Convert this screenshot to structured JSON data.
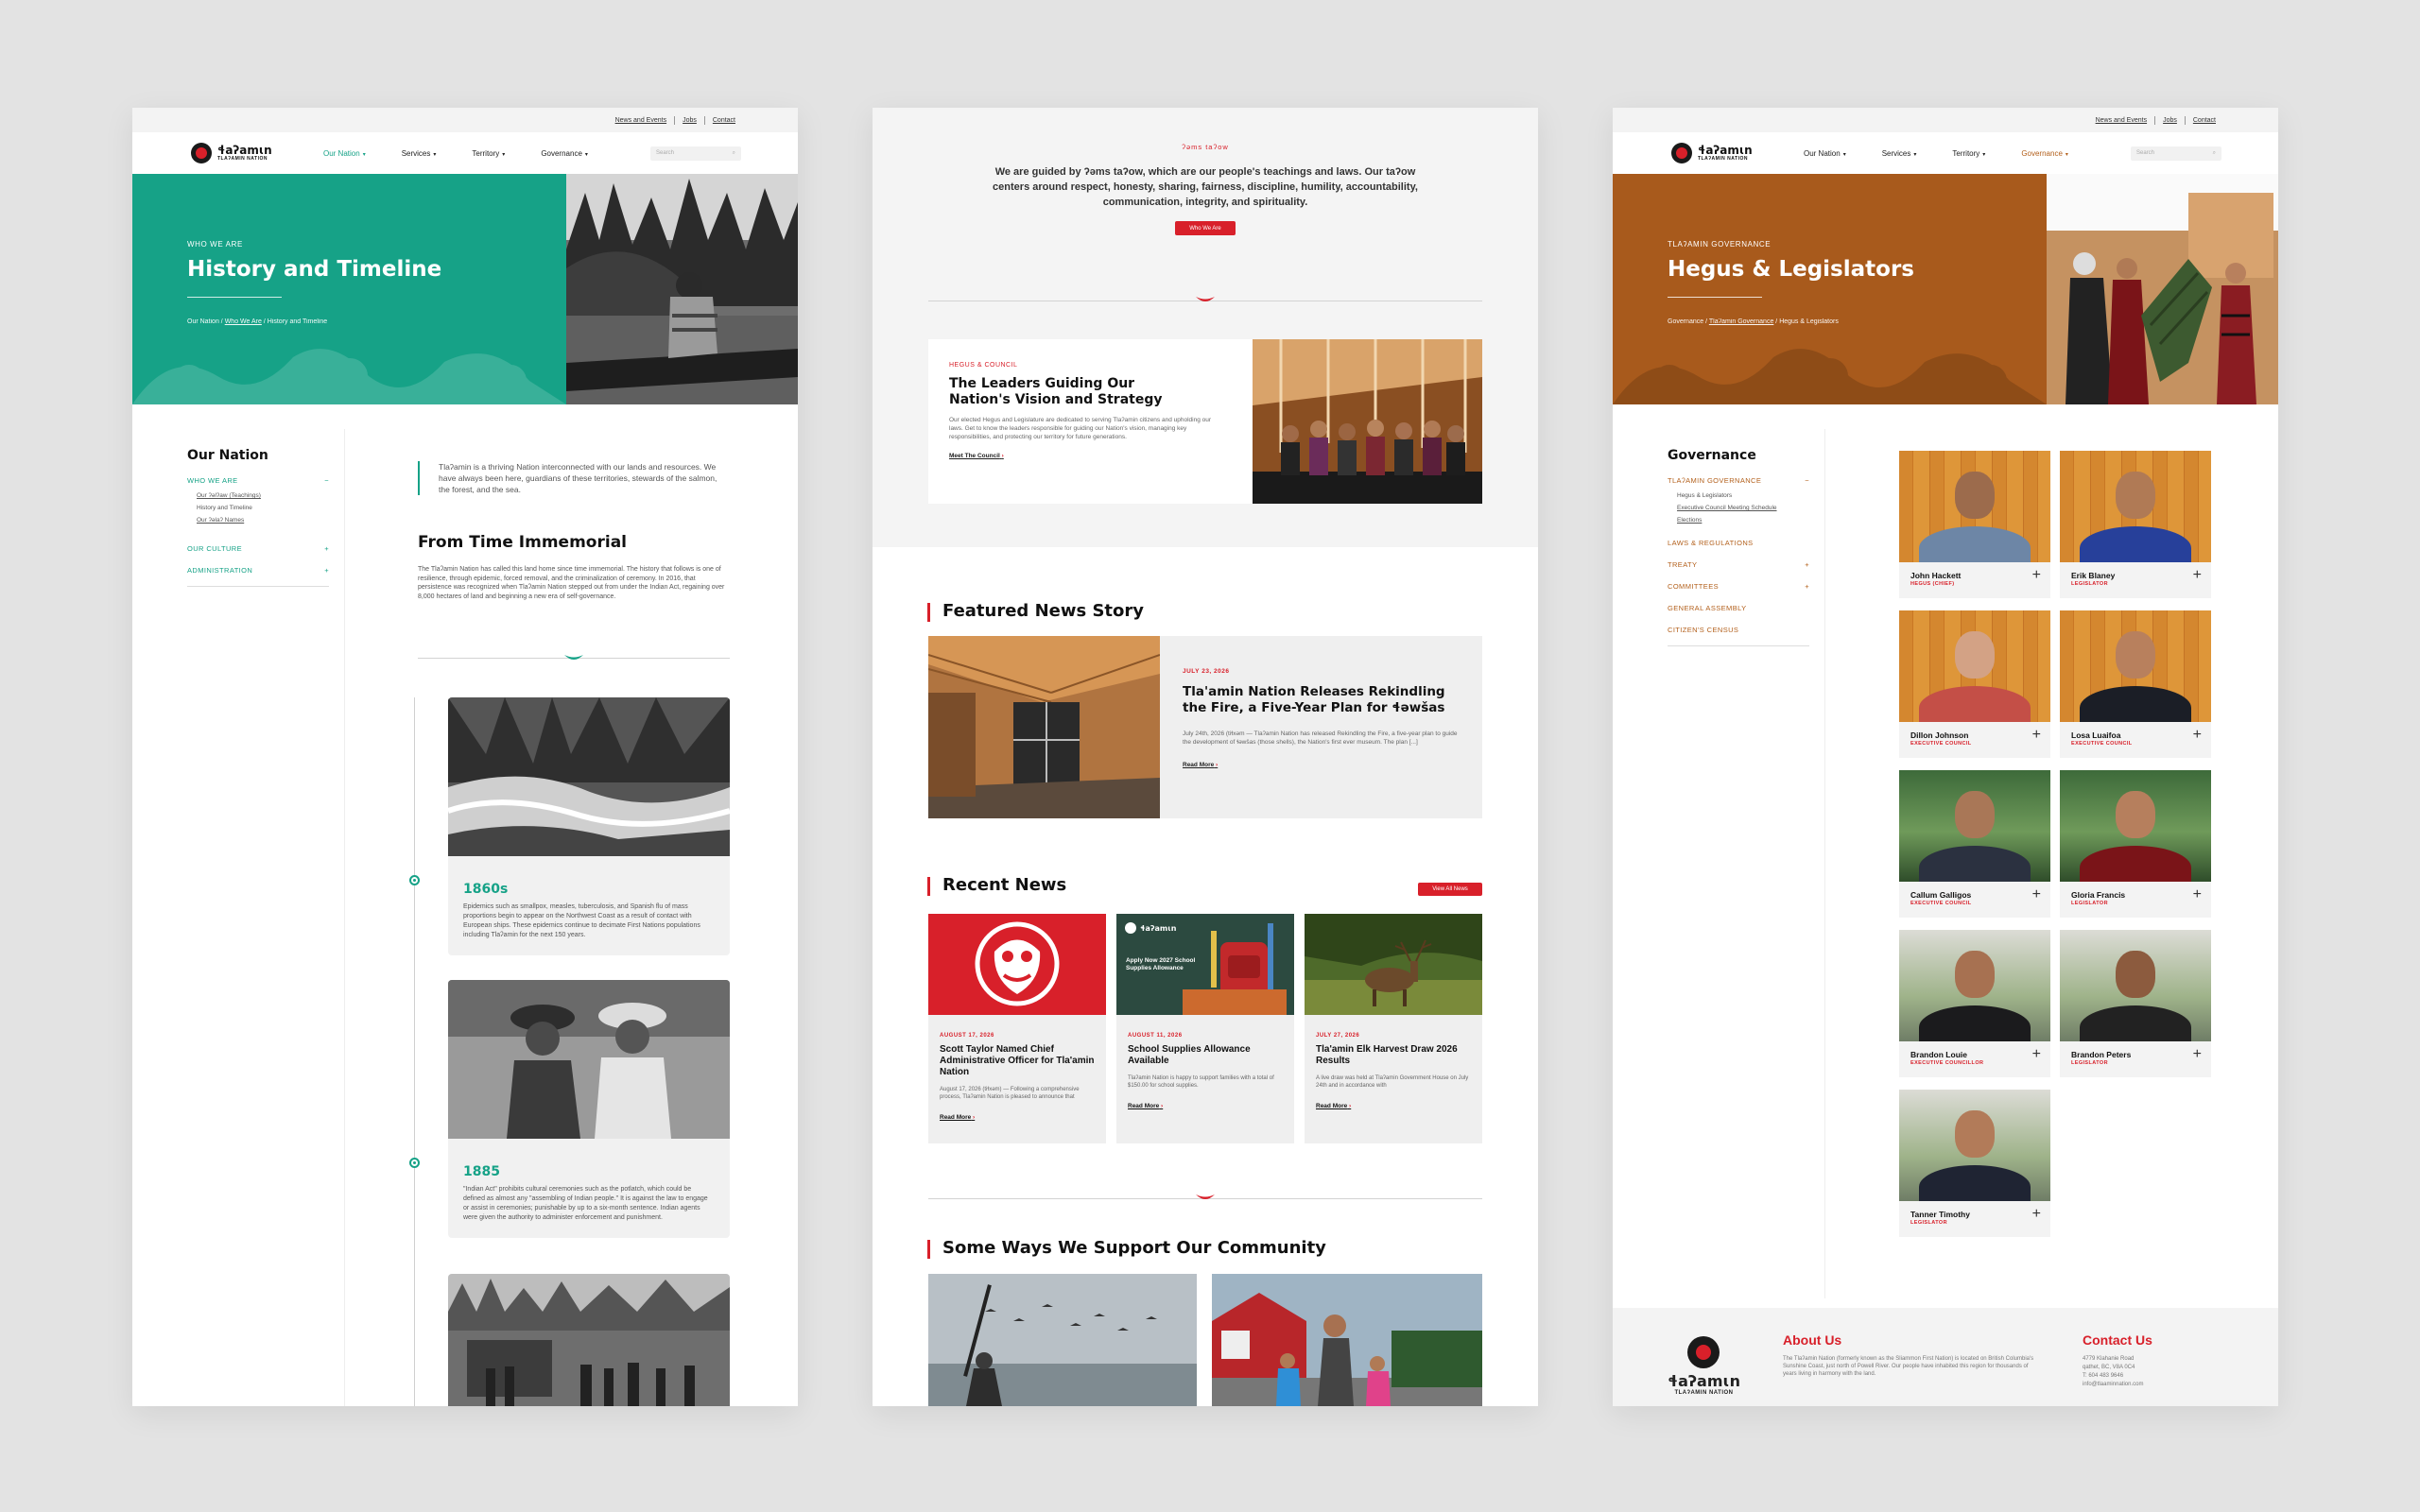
{
  "colors": {
    "teal": "#16a287",
    "red": "#d8202a",
    "brown": "#a85a1c",
    "bg": "#e3e3e3"
  },
  "site": {
    "logo_text": "ɬaʔamɩn",
    "logo_sub": "TLAʔAMIN NATION",
    "utility": [
      "News and Events",
      "Jobs",
      "Contact"
    ],
    "nav": [
      "Our Nation",
      "Services",
      "Territory",
      "Governance"
    ],
    "search_placeholder": "Search"
  },
  "page1": {
    "kicker": "WHO WE ARE",
    "title": "History and Timeline",
    "crumbs": [
      "Our Nation",
      "Who We Are",
      "History and Timeline"
    ],
    "sidebar": {
      "title": "Our Nation",
      "items": [
        {
          "label": "WHO WE ARE",
          "toggle": "−",
          "subs": [
            "Our ʔəlʔaw (Teachings)",
            "History and Timeline",
            "Our ʔəlaʔ Names"
          ]
        },
        {
          "label": "OUR CULTURE",
          "toggle": "+"
        },
        {
          "label": "ADMINISTRATION",
          "toggle": "+"
        }
      ]
    },
    "intro": "Tlaʔamin is a thriving Nation interconnected with our lands and resources. We have always been here, guardians of these territories, stewards of the salmon, the forest, and the sea.",
    "section_title": "From Time Immemorial",
    "section_text": "The Tlaʔamin Nation has called this land home since time immemorial. The history that follows is one of resilience, through epidemic, forced removal, and the criminalization of ceremony. In 2016, that persistence was recognized when Tlaʔamin Nation stepped out from under the Indian Act, regaining over 8,000 hectares of land and beginning a new era of self-governance.",
    "timeline": [
      {
        "year": "1860s",
        "text": "Epidemics such as smallpox, measles, tuberculosis, and Spanish flu of mass proportions begin to appear on the Northwest Coast as a result of contact with European ships. These epidemics continue to decimate First Nations populations including Tlaʔamin for the next 150 years."
      },
      {
        "year": "1885",
        "text": "\"Indian Act\" prohibits cultural ceremonies such as the potlatch, which could be defined as almost any \"assembling of Indian people.\" It is against the law to engage or assist in ceremonies; punishable by up to a six-month sentence. Indian agents were given the authority to administer enforcement and punishment."
      }
    ]
  },
  "page2": {
    "teachings_kicker": "ʔəms taʔow",
    "teachings_text": "We are guided by ʔəms taʔow, which are our people's teachings and laws. Our taʔow centers around respect, honesty, sharing, fairness, discipline, humility, accountability, communication, integrity, and spirituality.",
    "teachings_button": "Who We Are",
    "council_kicker": "HEGUS & COUNCIL",
    "council_title": "The Leaders Guiding Our Nation's Vision and Strategy",
    "council_text": "Our elected Hegus and Legislature are dedicated to serving Tlaʔamin citizens and upholding our laws. Get to know the leaders responsible for guiding our Nation's vision, managing key responsibilities, and protecting our territory for future generations.",
    "council_link": "Meet The Council",
    "featured_heading": "Featured News Story",
    "featured": {
      "date": "JULY 23, 2026",
      "title": "Tla'amin Nation Releases Rekindling the Fire, a Five-Year Plan for ɬəwšas",
      "text": "July 24th, 2026 (tiɬxəm — Tlaʔamin Nation has released Rekindling the Fire, a five-year plan to guide the development of ɬəwšas (those shells), the Nation's first ever museum. The plan [...]",
      "link": "Read More"
    },
    "recent_heading": "Recent News",
    "view_all": "View All News",
    "news": [
      {
        "date": "AUGUST 17, 2026",
        "title": "Scott Taylor Named Chief Administrative Officer for Tla'amin Nation",
        "text": "August 17, 2026 (tiɬxəm) — Following a comprehensive process, Tlaʔamin Nation is pleased to announce that",
        "link": "Read More"
      },
      {
        "date": "AUGUST 11, 2026",
        "title": "School Supplies Allowance Available",
        "text": "Tlaʔamin Nation is happy to support families with a total of $150.00 for school supplies.",
        "link": "Read More",
        "overlay_title": "Apply Now 2027 School Supplies Allowance"
      },
      {
        "date": "JULY 27, 2026",
        "title": "Tla'amin Elk Harvest Draw 2026 Results",
        "text": "A live draw was held at Tlaʔamin Government House on July 24th and in accordance with",
        "link": "Read More"
      }
    ],
    "support_heading": "Some Ways We Support Our Community"
  },
  "page3": {
    "kicker": "TLAʔAMIN GOVERNANCE",
    "title": "Hegus & Legislators",
    "crumbs": [
      "Governance",
      "Tlaʔamin Governance",
      "Hegus & Legislators"
    ],
    "sidebar": {
      "title": "Governance",
      "items": [
        {
          "label": "TLAʔAMIN GOVERNANCE",
          "toggle": "−",
          "subs": [
            "Hegus & Legislators",
            "Executive Council Meeting Schedule",
            "Elections"
          ]
        },
        {
          "label": "LAWS & REGULATIONS",
          "toggle": ""
        },
        {
          "label": "TREATY",
          "toggle": "+"
        },
        {
          "label": "COMMITTEES",
          "toggle": "+"
        },
        {
          "label": "GENERAL ASSEMBLY",
          "toggle": ""
        },
        {
          "label": "CITIZEN'S CENSUS",
          "toggle": ""
        }
      ]
    },
    "people": [
      {
        "name": "John Hackett",
        "role": "HEGUS (CHIEF)",
        "bg": "wood",
        "skin": "#9c6b4c",
        "shirt": "#6d86a6"
      },
      {
        "name": "Erik Blaney",
        "role": "LEGISLATOR",
        "bg": "wood",
        "skin": "#b07a55",
        "shirt": "#27409a"
      },
      {
        "name": "Dillon Johnson",
        "role": "EXECUTIVE COUNCIL",
        "bg": "wood",
        "skin": "#d3a285",
        "shirt": "#c44f47"
      },
      {
        "name": "Losa Luaifoa",
        "role": "EXECUTIVE COUNCIL",
        "bg": "wood",
        "skin": "#b8805d",
        "shirt": "#1b1e26"
      },
      {
        "name": "Callum Galligos",
        "role": "EXECUTIVE COUNCIL",
        "bg": "green",
        "skin": "#a97757",
        "shirt": "#2b3140"
      },
      {
        "name": "Gloria Francis",
        "role": "LEGISLATOR",
        "bg": "green",
        "skin": "#b67f5d",
        "shirt": "#7a1418"
      },
      {
        "name": "Brandon Louie",
        "role": "EXECUTIVE COUNCILLOR",
        "bg": "light",
        "skin": "#a77151",
        "shirt": "#1b1b1d"
      },
      {
        "name": "Brandon Peters",
        "role": "LEGISLATOR",
        "bg": "light",
        "skin": "#8c5b3e",
        "shirt": "#222"
      },
      {
        "name": "Tanner Timothy",
        "role": "LEGISLATOR",
        "bg": "light",
        "skin": "#b27b59",
        "shirt": "#1f2433"
      }
    ],
    "footer": {
      "about_heading": "About Us",
      "about_text": "The Tlaʔamin Nation (formerly known as the Sliammon First Nation) is located on British Columbia's Sunshine Coast, just north of Powell River. Our people have inhabited this region for thousands of years living in harmony with the land.",
      "contact_heading": "Contact Us",
      "address": [
        "4779 Klahanie Road",
        "qathet, BC, V8A 0C4"
      ],
      "phone": "T: 604 483 9646",
      "email": "info@tlaaminnation.com"
    }
  }
}
